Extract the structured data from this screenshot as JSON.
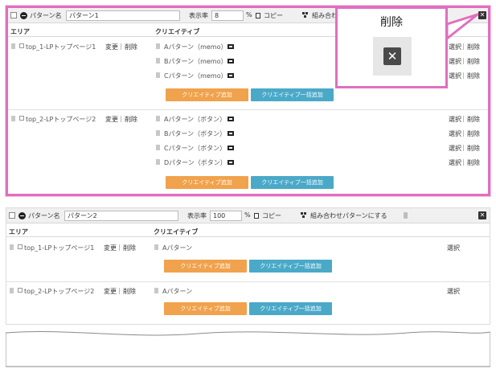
{
  "pattern1": {
    "checkbox": "",
    "label": "パターン名",
    "name_value": "パターン1",
    "rate_label": "表示率",
    "rate_value": "8",
    "percent": "%",
    "copy_label": "コピー",
    "combo_label": "組み合わせ",
    "columns": {
      "area": "エリア",
      "creative": "クリエイティブ"
    },
    "areas": [
      {
        "name": "top_1-LPトップページ1",
        "edit": "変更",
        "delete": "削除",
        "creatives": [
          {
            "name": "Aパターン（memo）",
            "select": "選択",
            "delete": "削除"
          },
          {
            "name": "Bパターン（memo）",
            "select": "選択",
            "delete": "削除"
          },
          {
            "name": "Cパターン（memo）",
            "select": "選択",
            "delete": "削除"
          }
        ]
      },
      {
        "name": "top_2-LPトップページ2",
        "edit": "変更",
        "delete": "削除",
        "creatives": [
          {
            "name": "Aパターン（ボタン）",
            "select": "選択",
            "delete": "削除"
          },
          {
            "name": "Bパターン（ボタン）",
            "select": "選択",
            "delete": "削除"
          },
          {
            "name": "Cパターン（ボタン）",
            "select": "選択",
            "delete": "削除"
          },
          {
            "name": "Dパターン（ボタン）",
            "select": "選択",
            "delete": "削除"
          }
        ]
      }
    ]
  },
  "pattern2": {
    "label": "パターン名",
    "name_value": "パターン2",
    "rate_label": "表示率",
    "rate_value": "100",
    "percent": "%",
    "copy_label": "コピー",
    "combo_label": "組み合わせパターンにする",
    "columns": {
      "area": "エリア",
      "creative": "クリエイティブ"
    },
    "areas": [
      {
        "name": "top_1-LPトップページ1",
        "edit": "変更",
        "delete": "削除",
        "creative": "Aパターン",
        "select": "選択"
      },
      {
        "name": "top_2-LPトップページ2",
        "edit": "変更",
        "delete": "削除",
        "creative": "Aパターン",
        "select": "選択"
      }
    ]
  },
  "buttons": {
    "add_creative": "クリエイティブ追加",
    "bulk_add_creative": "クリエイティブ一括追加"
  },
  "sep": "|",
  "close_glyph": "✕",
  "callout": {
    "title": "削除",
    "x_glyph": "✕"
  },
  "colors": {
    "highlight": "#e06fbf",
    "add_button": "#f0a24c",
    "bulk_button": "#4ba9c8"
  }
}
